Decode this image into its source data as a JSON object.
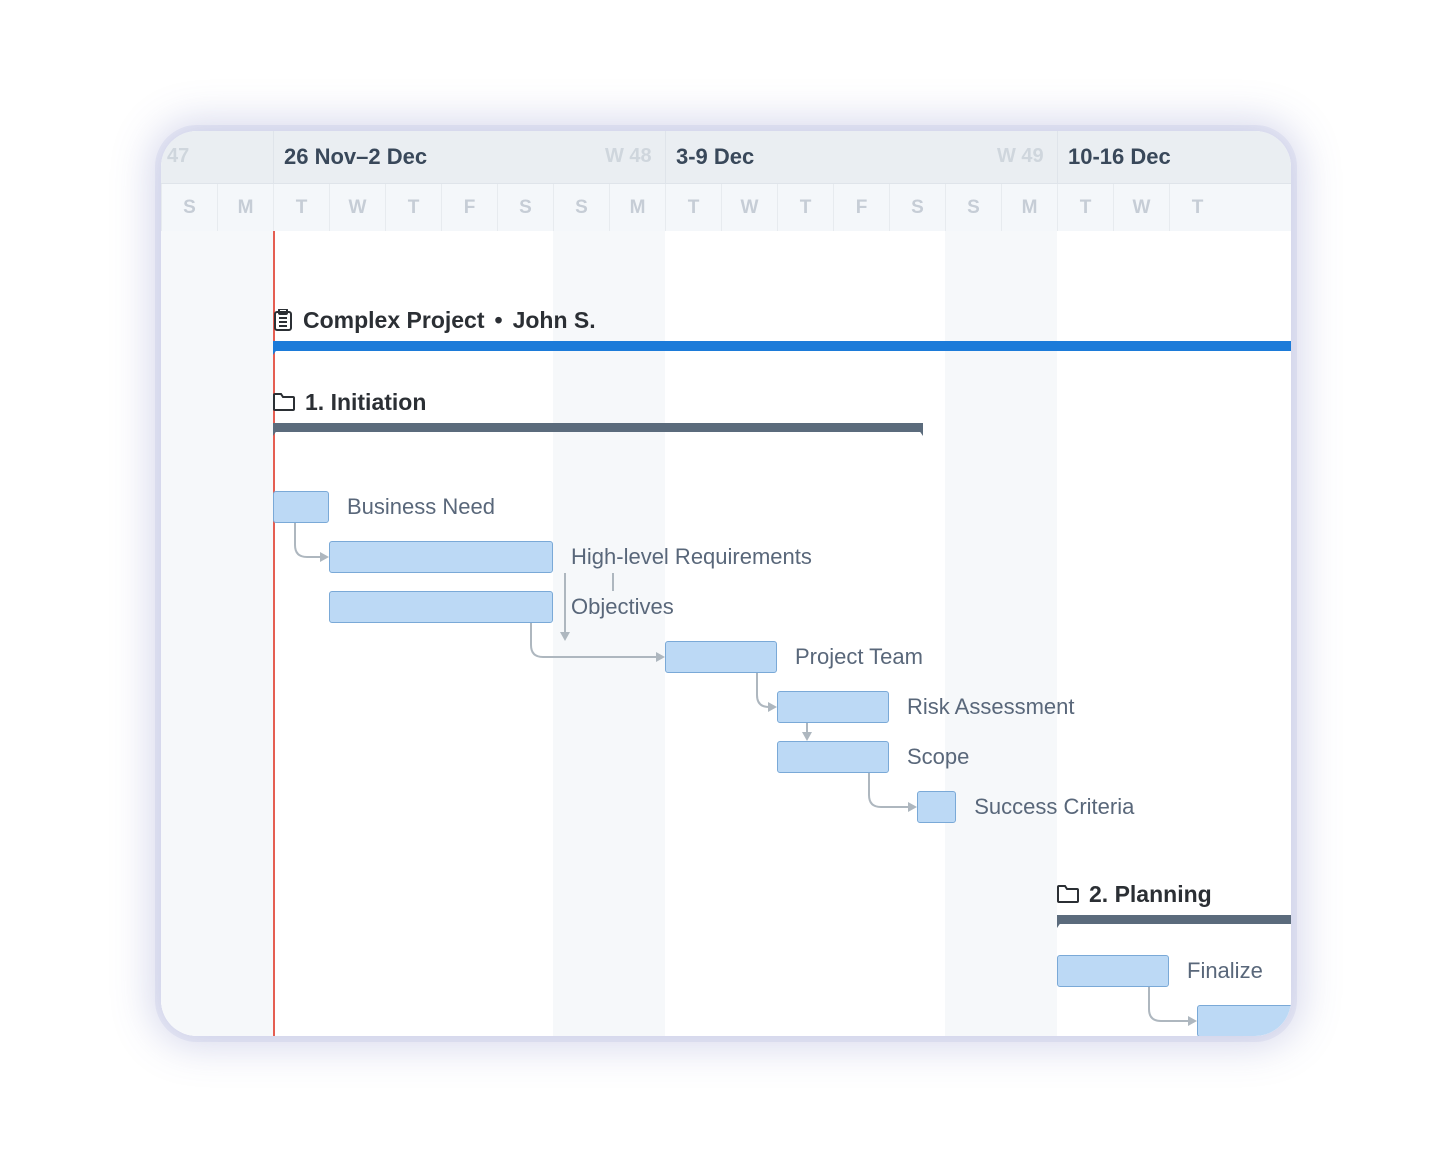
{
  "dayWidth": 56,
  "originDayIndex": -1,
  "todayLineDay": 1,
  "weeks": [
    {
      "num": "47",
      "range": "26 Nov–2 Dec",
      "startDay": 1,
      "span": 7
    },
    {
      "num": "48",
      "range": "3-9 Dec",
      "startDay": 8,
      "span": 7
    },
    {
      "num": "49",
      "range": "10-16 Dec",
      "startDay": 15,
      "span": 7
    }
  ],
  "weekNums": {
    "47": "47",
    "48": "W 48",
    "49": "W 49"
  },
  "dayLabels": [
    "S",
    "M",
    "T",
    "W",
    "T",
    "F",
    "S",
    "S",
    "M",
    "T",
    "W",
    "T",
    "F",
    "S",
    "S",
    "M",
    "T",
    "W",
    "T"
  ],
  "weekendBands": [
    {
      "startDay": -1,
      "span": 2
    },
    {
      "startDay": 6,
      "span": 2
    },
    {
      "startDay": 13,
      "span": 2
    },
    {
      "startDay": 20,
      "span": 1
    }
  ],
  "project": {
    "title": "Complex Project",
    "owner": "John S.",
    "barStartDay": 1,
    "barEndDay": 20
  },
  "group1": {
    "label": "1. Initiation",
    "barStartDay": 1,
    "barEndDay": 12.6
  },
  "tasks": [
    {
      "id": "business-need",
      "label": "Business Need",
      "startDay": 1,
      "endDay": 2,
      "row": 0
    },
    {
      "id": "hlr",
      "label": "High-level Requirements",
      "startDay": 2,
      "endDay": 6,
      "row": 1
    },
    {
      "id": "objectives",
      "label": "Objectives",
      "startDay": 2,
      "endDay": 6,
      "row": 2
    },
    {
      "id": "project-team",
      "label": "Project Team",
      "startDay": 8,
      "endDay": 10,
      "row": 3
    },
    {
      "id": "risk",
      "label": "Risk Assessment",
      "startDay": 10,
      "endDay": 12,
      "row": 4
    },
    {
      "id": "scope",
      "label": "Scope",
      "startDay": 10,
      "endDay": 12,
      "row": 5
    },
    {
      "id": "success",
      "label": "Success Criteria",
      "startDay": 12.5,
      "endDay": 13.2,
      "row": 6
    }
  ],
  "group2": {
    "label": "2. Planning",
    "barStartDay": 15,
    "barEndDay": 20
  },
  "task2": {
    "id": "finalize",
    "label": "Finalize",
    "startDay": 15,
    "endDay": 17
  },
  "task2b": {
    "id": "finalize-next",
    "startDay": 17.5,
    "endDay": 20
  },
  "layout": {
    "taskRowStartY": 260,
    "taskRowHeight": 50,
    "barHeight": 32,
    "labelGap": 18
  }
}
